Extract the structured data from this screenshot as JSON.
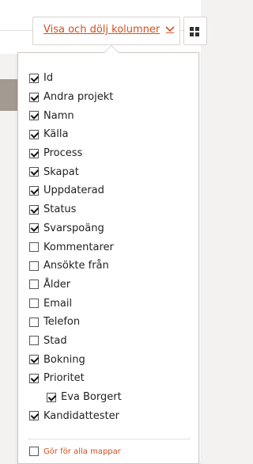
{
  "toolbar": {
    "toggle_label": "Visa och dölj kolumner",
    "chevron_icon": "chevron-down-icon",
    "view_icon": "grid-icon",
    "accent": "#d24f1f"
  },
  "columns": [
    {
      "label": "Id",
      "checked": true
    },
    {
      "label": "Andra projekt",
      "checked": true
    },
    {
      "label": "Namn",
      "checked": true
    },
    {
      "label": "Källa",
      "checked": true
    },
    {
      "label": "Process",
      "checked": true
    },
    {
      "label": "Skapat",
      "checked": true
    },
    {
      "label": "Uppdaterad",
      "checked": true
    },
    {
      "label": "Status",
      "checked": true
    },
    {
      "label": "Svarspoäng",
      "checked": true
    },
    {
      "label": "Kommentarer",
      "checked": false
    },
    {
      "label": "Ansökte från",
      "checked": false
    },
    {
      "label": "Ålder",
      "checked": false
    },
    {
      "label": "Email",
      "checked": false
    },
    {
      "label": "Telefon",
      "checked": false
    },
    {
      "label": "Stad",
      "checked": false
    },
    {
      "label": "Bokning",
      "checked": true
    },
    {
      "label": "Prioritet",
      "checked": true
    },
    {
      "label": "Eva Borgert",
      "checked": true,
      "sub": true
    },
    {
      "label": "Kandidattester",
      "checked": true
    }
  ],
  "apply_all": {
    "label": "Gör för alla mappar",
    "checked": false
  }
}
